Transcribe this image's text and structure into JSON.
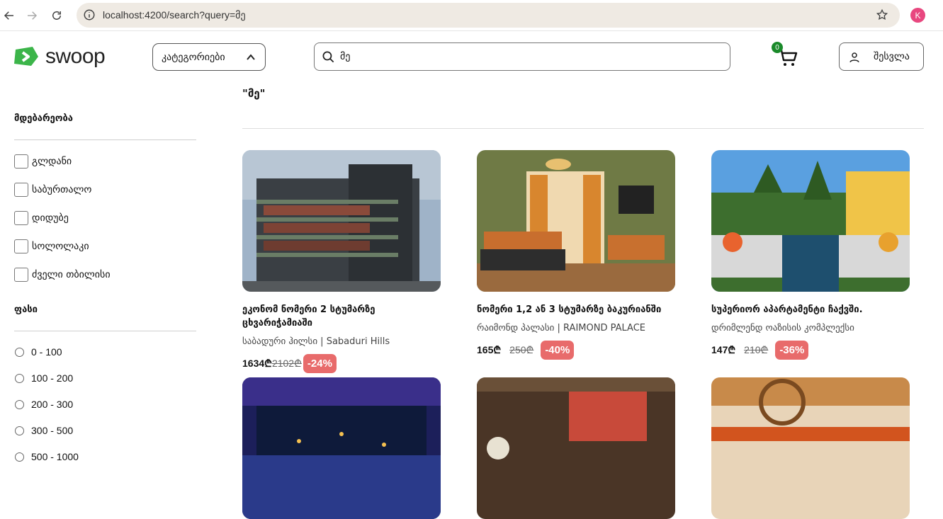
{
  "browser": {
    "url": "localhost:4200/search?query=მე",
    "profile_initial": "K"
  },
  "header": {
    "logo_text": "swoop",
    "categories_label": "კატეგორიები",
    "search_value": "მე",
    "cart_count": "0",
    "login_label": "შესვლა"
  },
  "sidebar": {
    "location_title": "მდებარეობა",
    "locations": [
      "გლდანი",
      "საბურთალო",
      "დიდუბე",
      "სოლოლაკი",
      "ძველი თბილისი"
    ],
    "price_title": "ფასი",
    "price_ranges": [
      "0 - 100",
      "100 - 200",
      "200 - 300",
      "300 - 500",
      "500 - 1000"
    ]
  },
  "main": {
    "query_title": "\"მე\"",
    "cards": [
      {
        "title": "ეკონომ ნომერი 2 სტუმარზე ცხვარიჭამიაში",
        "subtitle": "საბადური ჰილსი | Sabaduri Hills",
        "price": "1634₾",
        "old_price": "2102₾",
        "discount": "-24%"
      },
      {
        "title": "ნომერი 1,2 ან 3 სტუმარზე ბაკურიანში",
        "subtitle": "რაიმონდ პალასი | RAIMOND PALACE",
        "price": "165₾",
        "old_price": "250₾",
        "discount": "-40%"
      },
      {
        "title": "სუპერიორ აპარტამენტი ჩაქვში.",
        "subtitle": "დრიმლენდ ოაზისის კომპლექსი",
        "price": "147₾",
        "old_price": "210₾",
        "discount": "-36%"
      }
    ]
  },
  "colors": {
    "brand_green": "#3cb54a",
    "discount_red": "#e86b6b",
    "cart_badge": "#1a8a2a"
  }
}
